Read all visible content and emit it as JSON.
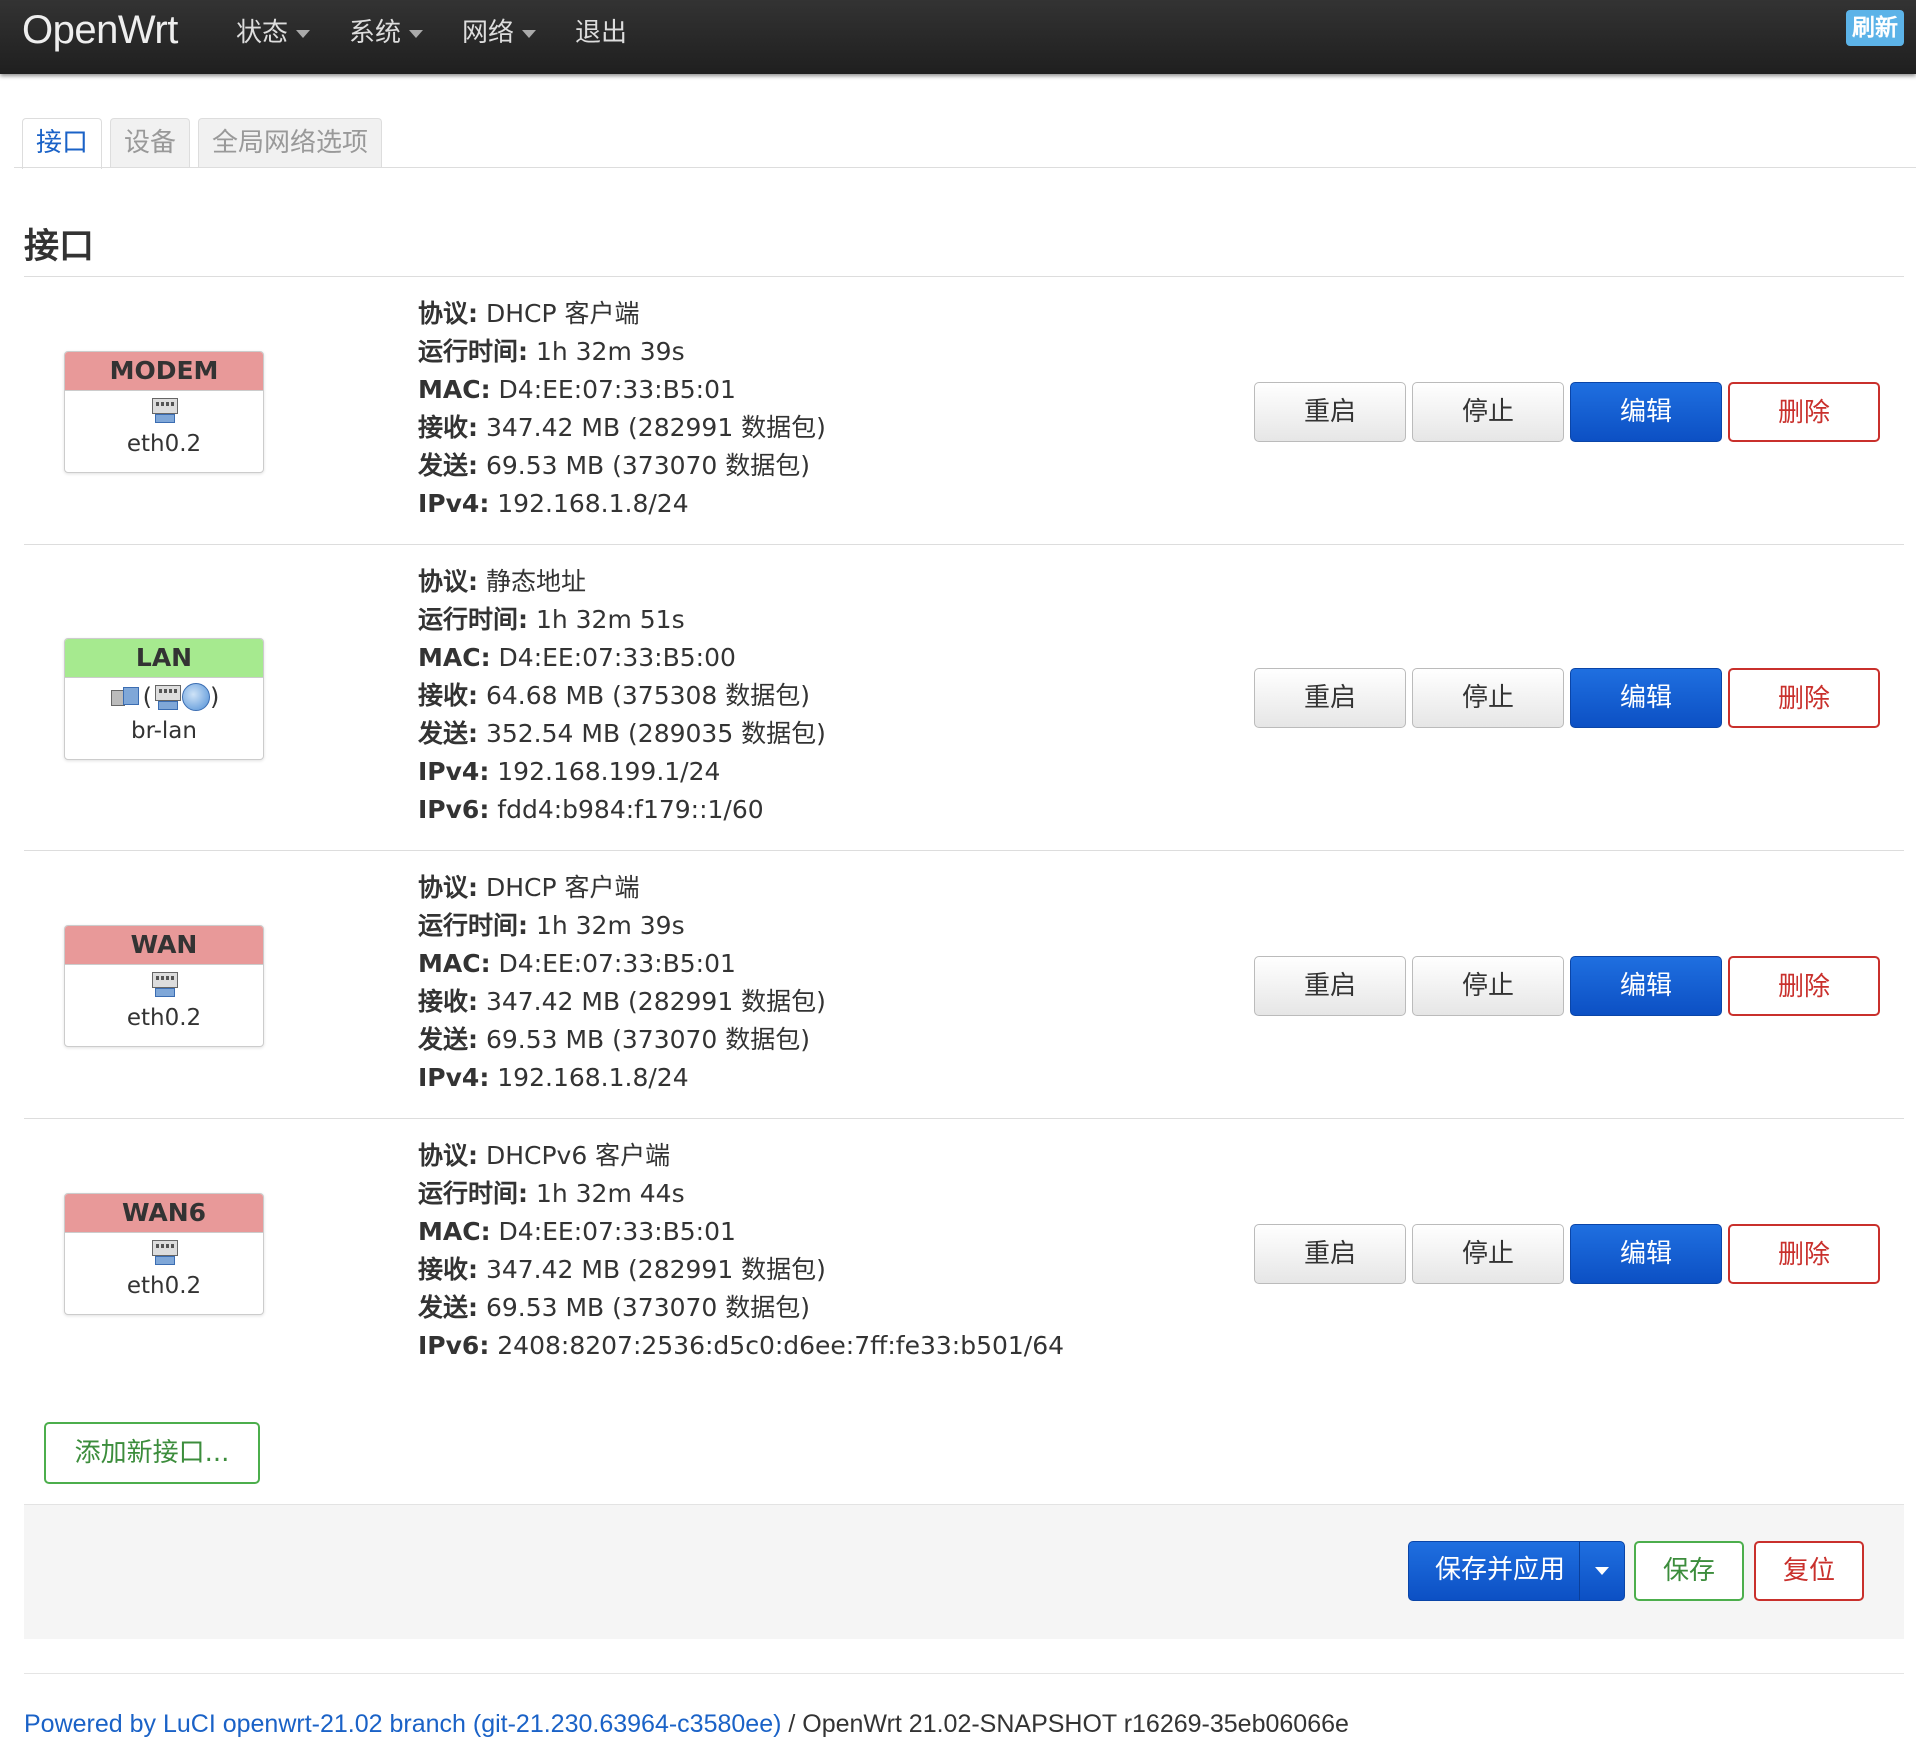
{
  "navbar": {
    "brand": "OpenWrt",
    "menu": [
      "状态",
      "系统",
      "网络",
      "退出"
    ],
    "refresh": "刷新"
  },
  "tabs": [
    "接口",
    "设备",
    "全局网络选项"
  ],
  "page_title": "接口",
  "labels": {
    "protocol": "协议:",
    "uptime": "运行时间:",
    "mac": "MAC:",
    "rx": "接收:",
    "tx": "发送:",
    "ipv4": "IPv4:",
    "ipv6": "IPv6:"
  },
  "row_buttons": {
    "restart": "重启",
    "stop": "停止",
    "edit": "编辑",
    "delete": "删除"
  },
  "interfaces": [
    {
      "name": "MODEM",
      "color": "#e89999",
      "device": "eth0.2",
      "protocol": "DHCP 客户端",
      "uptime": "1h 32m 39s",
      "mac": "D4:EE:07:33:B5:01",
      "rx": "347.42 MB (282991 数据包)",
      "tx": "69.53 MB (373070 数据包)",
      "ipv4": "192.168.1.8/24"
    },
    {
      "name": "LAN",
      "color": "#a6ea8f",
      "device": "br-lan",
      "paren_open": "(",
      "paren_close": ")",
      "protocol": "静态地址",
      "uptime": "1h 32m 51s",
      "mac": "D4:EE:07:33:B5:00",
      "rx": "64.68 MB (375308 数据包)",
      "tx": "352.54 MB (289035 数据包)",
      "ipv4": "192.168.199.1/24",
      "ipv6": "fdd4:b984:f179::1/60"
    },
    {
      "name": "WAN",
      "color": "#e89999",
      "device": "eth0.2",
      "protocol": "DHCP 客户端",
      "uptime": "1h 32m 39s",
      "mac": "D4:EE:07:33:B5:01",
      "rx": "347.42 MB (282991 数据包)",
      "tx": "69.53 MB (373070 数据包)",
      "ipv4": "192.168.1.8/24"
    },
    {
      "name": "WAN6",
      "color": "#e89999",
      "device": "eth0.2",
      "protocol": "DHCPv6 客户端",
      "uptime": "1h 32m 44s",
      "mac": "D4:EE:07:33:B5:01",
      "rx": "347.42 MB (282991 数据包)",
      "tx": "69.53 MB (373070 数据包)",
      "ipv6": "2408:8207:2536:d5c0:d6ee:7ff:fe33:b501/64"
    }
  ],
  "add_interface": "添加新接口...",
  "actions": {
    "save_apply": "保存并应用",
    "save": "保存",
    "reset": "复位"
  },
  "footer": {
    "link": "Powered by LuCI openwrt-21.02 branch (git-21.230.63964-c3580ee)",
    "rest": " / OpenWrt 21.02-SNAPSHOT r16269-35eb06066e"
  }
}
